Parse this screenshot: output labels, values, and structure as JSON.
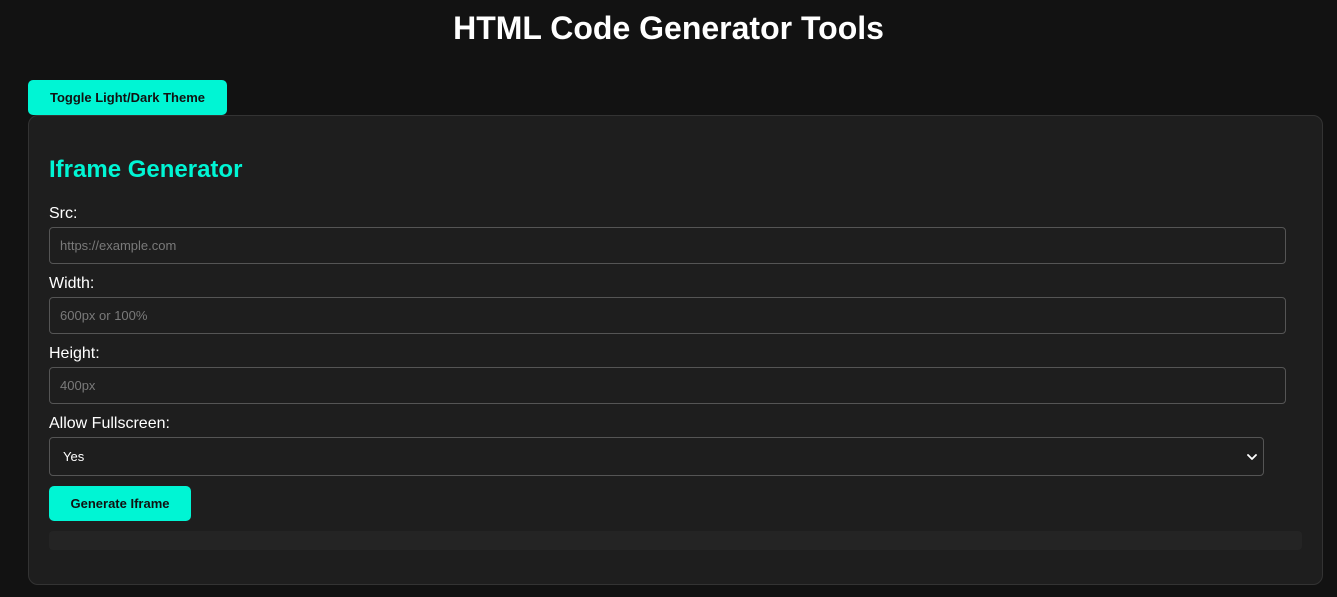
{
  "page": {
    "title": "HTML Code Generator Tools"
  },
  "toolbar": {
    "theme_toggle_label": "Toggle Light/Dark Theme"
  },
  "iframe_generator": {
    "title": "Iframe Generator",
    "src": {
      "label": "Src:",
      "placeholder": "https://example.com",
      "value": ""
    },
    "width": {
      "label": "Width:",
      "placeholder": "600px or 100%",
      "value": ""
    },
    "height": {
      "label": "Height:",
      "placeholder": "400px",
      "value": ""
    },
    "allow_fullscreen": {
      "label": "Allow Fullscreen:",
      "selected": "Yes"
    },
    "generate_label": "Generate Iframe"
  },
  "icons": {
    "select_arrow": "chevron-down-icon"
  },
  "colors": {
    "accent": "#00f5d4",
    "background": "#121212",
    "panel": "#1e1e1e",
    "border": "#555555"
  }
}
